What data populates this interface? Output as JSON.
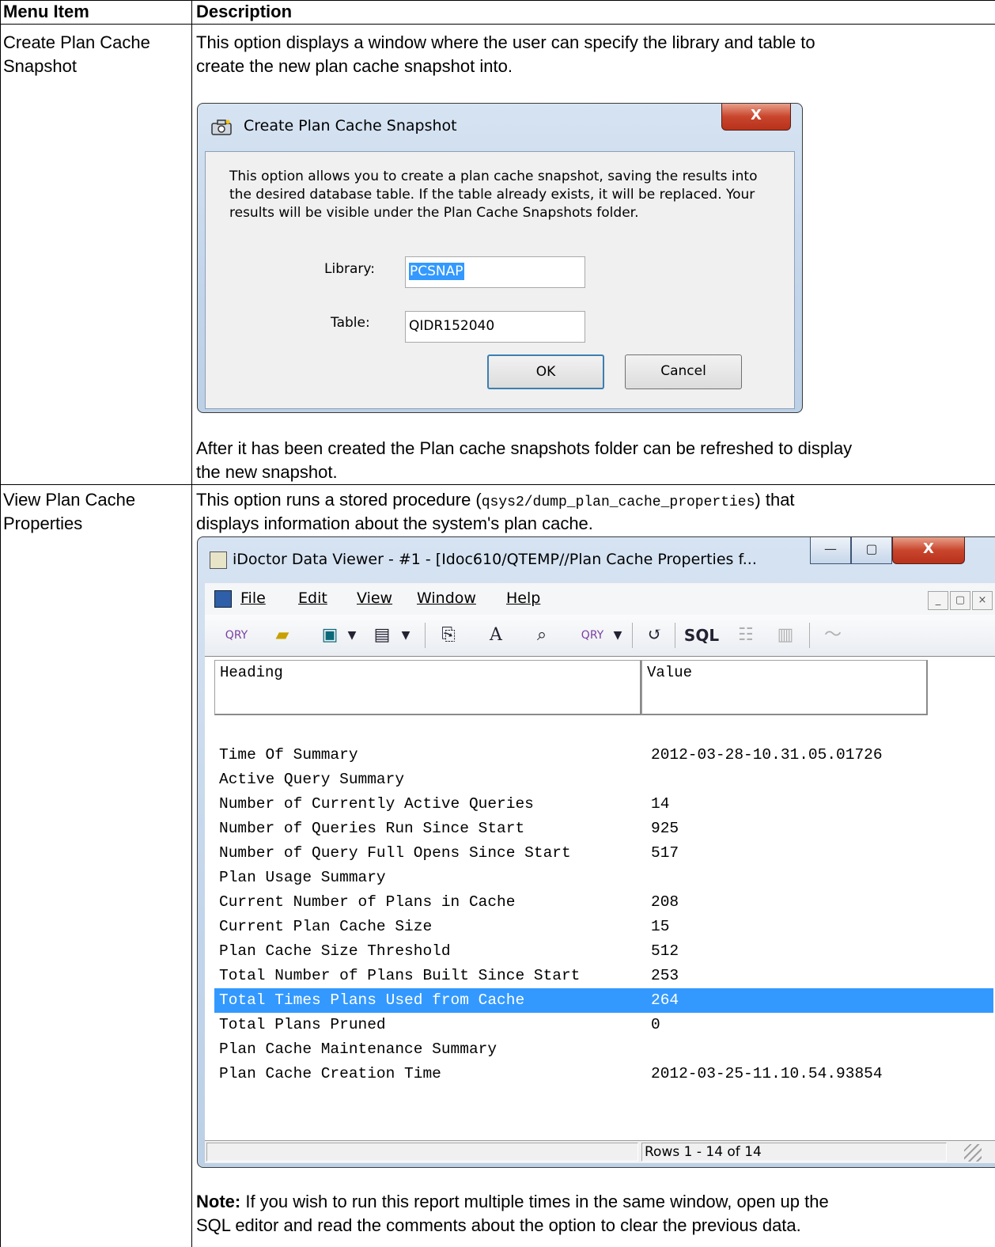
{
  "table": {
    "col_menu_item": "Menu Item",
    "col_description": "Description",
    "rows": [
      {
        "menu_item": "Create Plan Cache Snapshot",
        "menu_line1": "Create Plan Cache",
        "menu_line2": "Snapshot",
        "desc_line1": "This option displays a window where the user can specify the library and table to",
        "desc_line2": "create the new plan cache snapshot into.",
        "after_line1": "After it has been created the Plan cache snapshots folder can be refreshed to display",
        "after_line2": "the new snapshot."
      },
      {
        "menu_line1": "View Plan Cache",
        "menu_line2": "Properties",
        "desc_pre": "This option runs a stored procedure (",
        "desc_code": "qsys2/dump_plan_cache_properties",
        "desc_post": ") that",
        "desc_line2": "displays information about the system's plan cache.",
        "note_label": "Note:",
        "note_line1": " If you wish to run this report multiple times in the same window, open up the",
        "note_line2": "SQL editor and read the comments about the option to clear the previous data."
      }
    ]
  },
  "snapshot_dialog": {
    "title": "Create Plan Cache Snapshot",
    "close_glyph": "X",
    "message": "This option allows you to create a plan cache snapshot, saving the results into the desired database table.  If the table already exists, it will be replaced.  Your results will be visible under the Plan Cache Snapshots folder.",
    "library_label": "Library:",
    "library_value": "PCSNAP",
    "table_label": "Table:",
    "table_value": "QIDR152040",
    "ok_label": "OK",
    "cancel_label": "Cancel"
  },
  "viewer": {
    "title": "iDoctor Data Viewer - #1 - [Idoc610/QTEMP//Plan Cache Properties f...",
    "minimize_glyph": "—",
    "restore_glyph": "▢",
    "close_glyph": "X",
    "menus": [
      "File",
      "Edit",
      "View",
      "Window",
      "Help"
    ],
    "toolbar_sql": "SQL",
    "toolbar_font": "A",
    "columns": [
      "Heading",
      "Value"
    ],
    "rows": [
      {
        "heading": "Time Of Summary",
        "value": "2012-03-28-10.31.05.01726"
      },
      {
        "heading": "Active Query Summary",
        "value": ""
      },
      {
        "heading": "Number of Currently Active Queries",
        "value": "14"
      },
      {
        "heading": "Number of Queries Run Since Start",
        "value": "925"
      },
      {
        "heading": "Number of Query Full Opens Since Start",
        "value": "517"
      },
      {
        "heading": "Plan Usage Summary",
        "value": ""
      },
      {
        "heading": "Current Number of Plans in Cache",
        "value": "208"
      },
      {
        "heading": "Current Plan Cache Size",
        "value": "15"
      },
      {
        "heading": "Plan Cache Size Threshold",
        "value": "512"
      },
      {
        "heading": "Total Number of Plans Built Since Start",
        "value": "253"
      },
      {
        "heading": "Total Times Plans Used from Cache",
        "value": "264"
      },
      {
        "heading": "Total Plans Pruned",
        "value": "0"
      },
      {
        "heading": "Plan Cache Maintenance Summary",
        "value": ""
      },
      {
        "heading": "Plan Cache Creation Time",
        "value": "2012-03-25-11.10.54.93854"
      }
    ],
    "selected_row": 10,
    "status": "Rows 1 - 14 of 14"
  }
}
